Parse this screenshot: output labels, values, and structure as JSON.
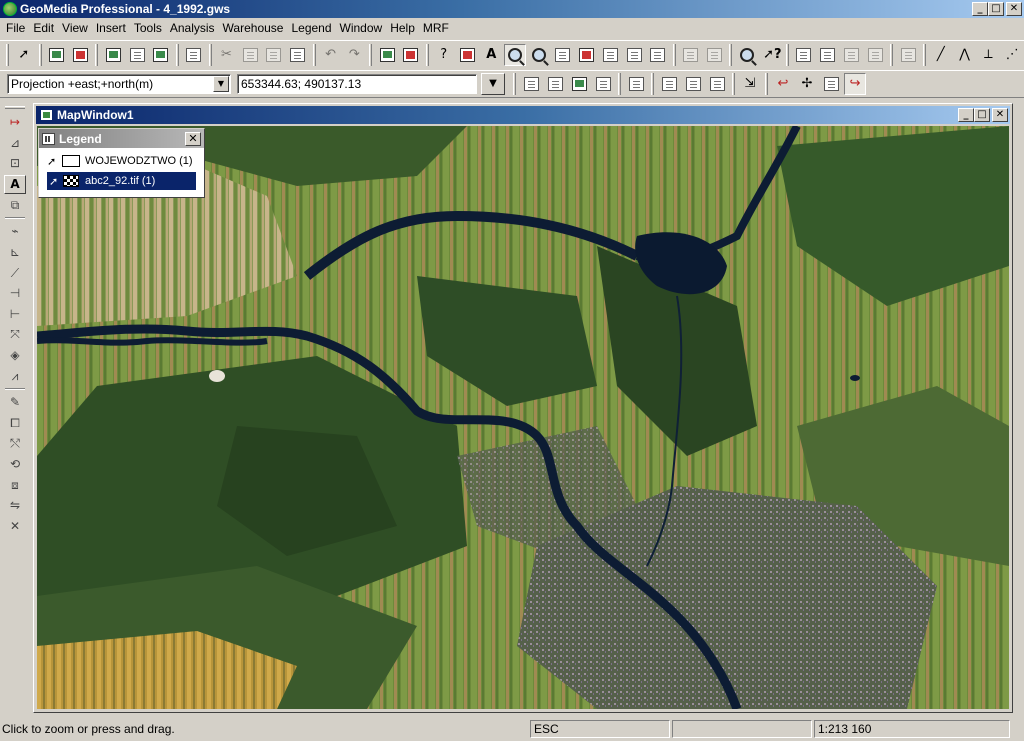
{
  "window": {
    "title": "GeoMedia Professional - 4_1992.gws",
    "minimize": "_",
    "restore": "□",
    "close": "✕"
  },
  "menu": [
    "File",
    "Edit",
    "View",
    "Insert",
    "Tools",
    "Analysis",
    "Warehouse",
    "Legend",
    "Window",
    "Help",
    "MRF"
  ],
  "toolbar2": {
    "projection_value": "Projection +east;+north(m)",
    "coordinate_value": "653344.63; 490137.13"
  },
  "map_window": {
    "title": "MapWindow1"
  },
  "legend": {
    "title": "Legend",
    "close": "✕",
    "entries": [
      {
        "label": "WOJEWODZTWO  (1)",
        "selected": false
      },
      {
        "label": "abc2_92.tif  (1)",
        "selected": true
      }
    ]
  },
  "status": {
    "message": "Click to zoom or press and drag.",
    "key": "ESC",
    "scale": "1:213 160"
  },
  "colors": {
    "title_active": "#0a246a",
    "water": "#0b1d3a",
    "forest": "#2c4a22",
    "farmland": "#6e8a3a"
  }
}
